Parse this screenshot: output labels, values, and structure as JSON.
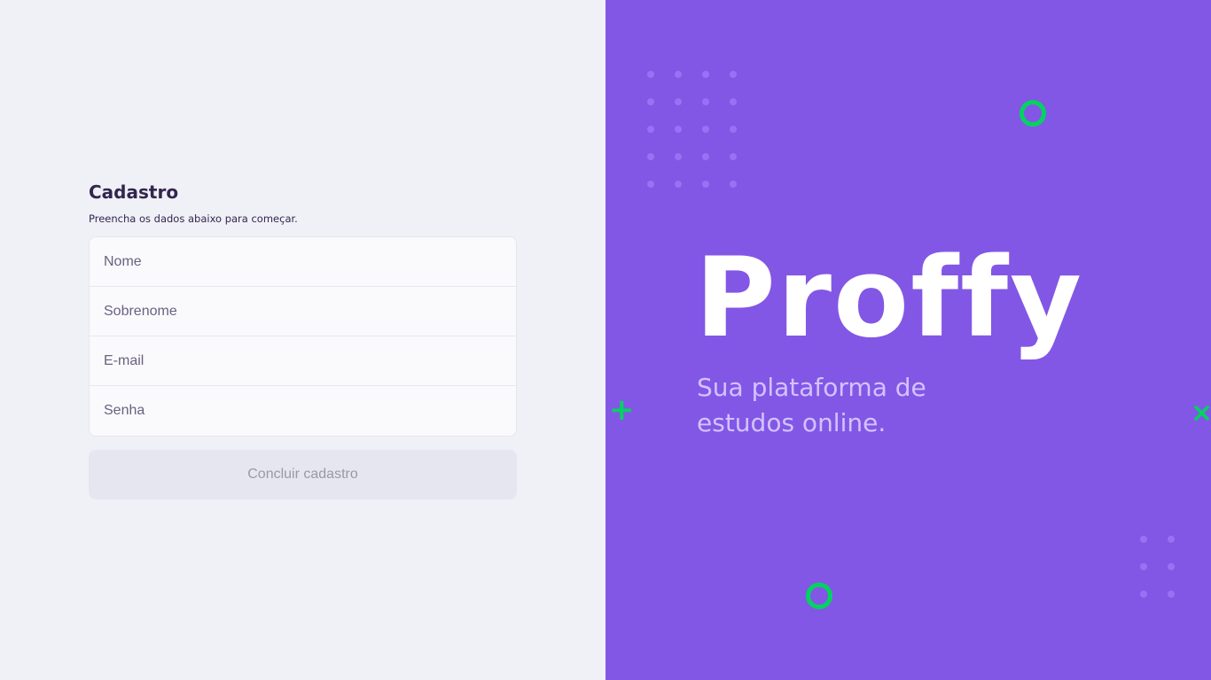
{
  "form": {
    "title": "Cadastro",
    "subtitle": "Preencha os dados abaixo para começar.",
    "fields": [
      {
        "placeholder": "Nome"
      },
      {
        "placeholder": "Sobrenome"
      },
      {
        "placeholder": "E-mail"
      },
      {
        "placeholder": "Senha"
      }
    ],
    "submit_label": "Concluir cadastro"
  },
  "brand": {
    "logo_text": "Proffy",
    "tagline": "Sua plataforma de estudos online."
  },
  "colors": {
    "primary": "#8257E5",
    "accent": "#04D361",
    "background": "#F0F0F7"
  },
  "icons": [
    "plus-decoration-icon",
    "cross-decoration-icon",
    "ring-decoration-icon",
    "dots-pattern-icon"
  ]
}
